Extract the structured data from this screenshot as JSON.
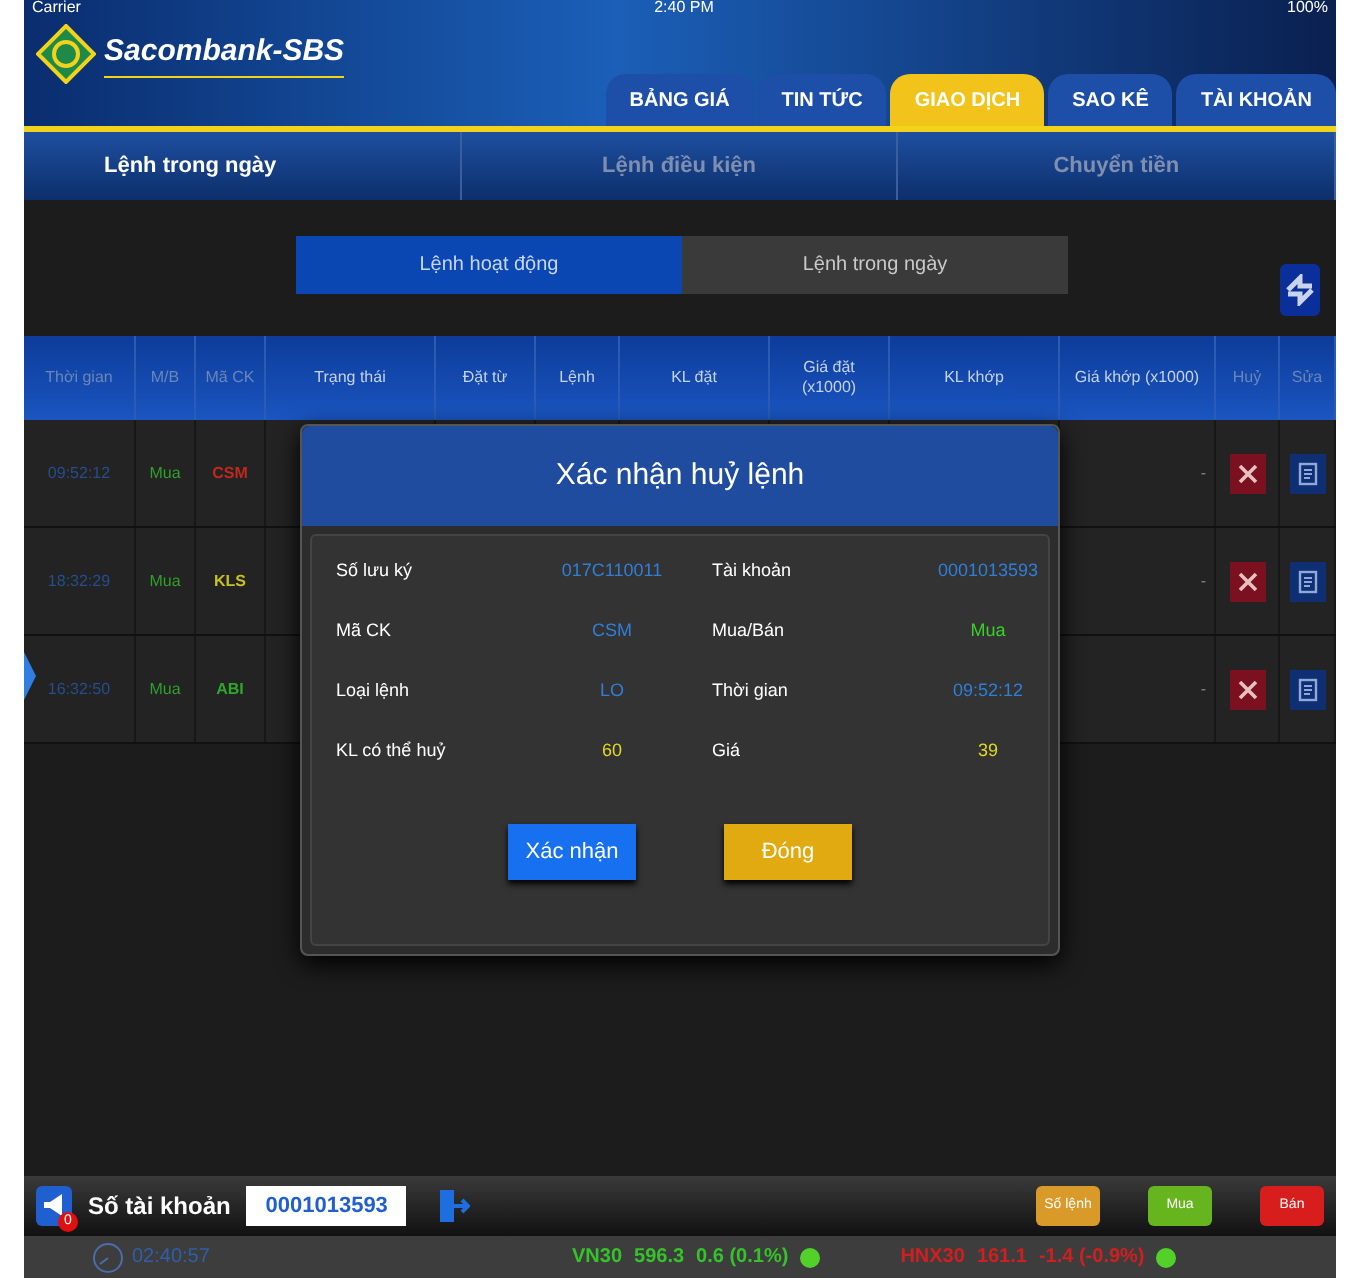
{
  "status_bar": {
    "carrier": "Carrier",
    "time": "2:40 PM",
    "battery": "100%"
  },
  "header": {
    "brand": "Sacombank-SBS"
  },
  "tabs": [
    {
      "label": "BẢNG GIÁ",
      "selected": false
    },
    {
      "label": "TIN TỨC",
      "selected": false
    },
    {
      "label": "GIAO DỊCH",
      "selected": true
    },
    {
      "label": "SAO KÊ",
      "selected": false
    },
    {
      "label": "TÀI KHOẢN",
      "selected": false
    }
  ],
  "subtabs": [
    {
      "label": "Lệnh trong ngày",
      "selected": true
    },
    {
      "label": "Lệnh điều kiện",
      "selected": false
    },
    {
      "label": "Chuyển tiền",
      "selected": false
    }
  ],
  "segments": [
    {
      "label": "Lệnh hoạt động",
      "selected": true
    },
    {
      "label": "Lệnh trong ngày",
      "selected": false
    }
  ],
  "table": {
    "columns": [
      "Thời gian",
      "M/B",
      "Mã CK",
      "Trạng thái",
      "Đặt từ",
      "Lệnh",
      "KL đặt",
      "Giá đặt\n(x1000)",
      "KL khớp",
      "Giá khớp (x1000)",
      "Huỷ",
      "Sửa"
    ],
    "rows": [
      {
        "time": "09:52:12",
        "side": "Mua",
        "symbol": "CSM",
        "color": "#c0281e",
        "matched_price": "-"
      },
      {
        "time": "18:32:29",
        "side": "Mua",
        "symbol": "KLS",
        "color": "#c8c21e",
        "matched_price": "-"
      },
      {
        "time": "16:32:50",
        "side": "Mua",
        "symbol": "ABI",
        "color": "#2ea82a",
        "matched_price": "-"
      }
    ]
  },
  "dialog": {
    "title": "Xác nhận huỷ lệnh",
    "fields": [
      {
        "label": "Số lưu ký",
        "value": "017C110011",
        "color": "#2f7fd8"
      },
      {
        "label": "Tài khoản",
        "value": "0001013593",
        "color": "#2f7fd8"
      },
      {
        "label": "Mã CK",
        "value": "CSM",
        "color": "#2f7fd8"
      },
      {
        "label": "Mua/Bán",
        "value": "Mua",
        "color": "#39d12a"
      },
      {
        "label": "Loại lệnh",
        "value": "LO",
        "color": "#2f7fd8"
      },
      {
        "label": "Thời gian",
        "value": "09:52:12",
        "color": "#2f7fd8"
      },
      {
        "label": "KL có thể huỷ",
        "value": "60",
        "color": "#e3d923"
      },
      {
        "label": "Giá",
        "value": "39",
        "color": "#e3d923"
      }
    ],
    "buttons": [
      {
        "label": "Xác nhận",
        "kind": "confirm"
      },
      {
        "label": "Đóng",
        "kind": "close"
      }
    ]
  },
  "bottom_bar": {
    "notification_count": "0",
    "account_label": "Số tài khoản",
    "account_value": "0001013593",
    "buttons": [
      {
        "label": "Số lệnh",
        "kind": "orders"
      },
      {
        "label": "Mua",
        "kind": "buy"
      },
      {
        "label": "Bán",
        "kind": "sell"
      }
    ]
  },
  "footer": {
    "time": "02:40:57",
    "indices": [
      {
        "name": "VN30",
        "value": "596.3",
        "change": "0.6 (0.1%)",
        "color": "#35c22a"
      },
      {
        "name": "HNX30",
        "value": "161.1",
        "change": "-1.4 (-0.9%)",
        "color": "#d11f1f"
      }
    ]
  }
}
